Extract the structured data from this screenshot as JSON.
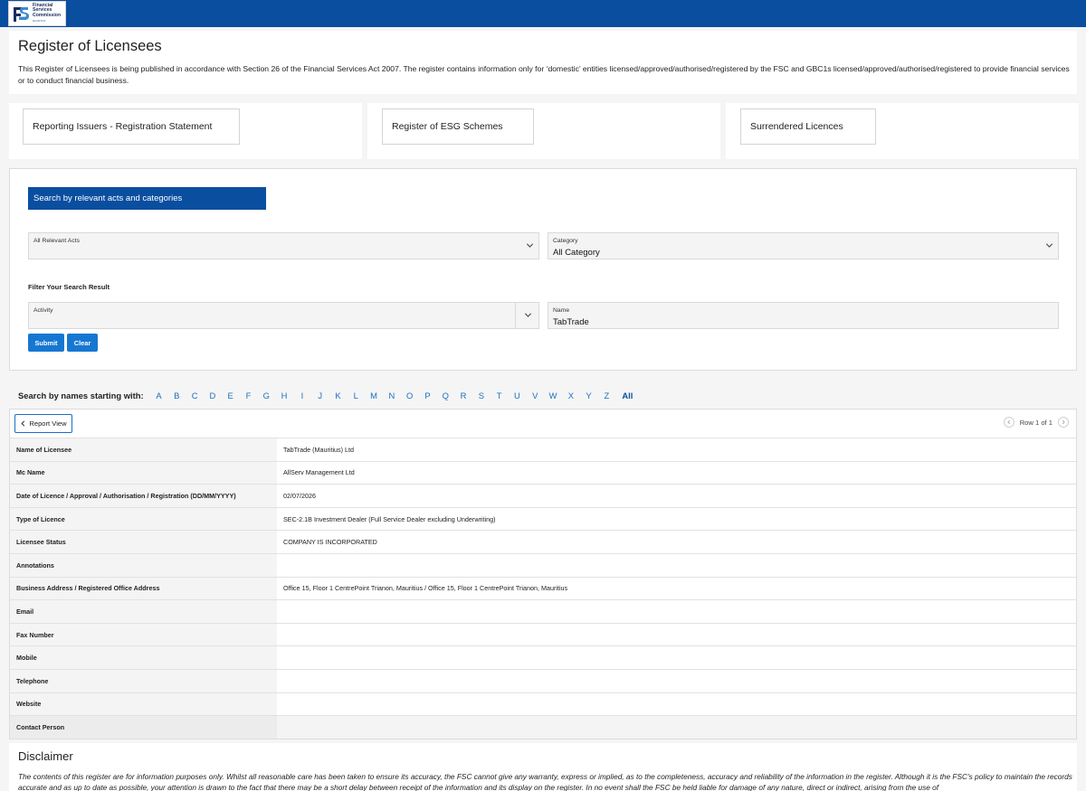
{
  "header": {
    "logo_line1": "Financial",
    "logo_line2": "Services",
    "logo_line3": "Commission",
    "logo_line4": "MAURITIUS"
  },
  "intro": {
    "title": "Register of Licensees",
    "text": "This Register of Licensees is being published in accordance with Section 26 of the Financial Services Act 2007. The register contains information only for ‘domestic’ entities licensed/approved/authorised/registered by the FSC and GBC1s licensed/approved/authorised/registered to provide financial services or to conduct financial business."
  },
  "cards": [
    {
      "label": "Reporting Issuers - Registration Statement"
    },
    {
      "label": "Register of ESG Schemes"
    },
    {
      "label": "Surrendered Licences"
    }
  ],
  "search": {
    "header": "Search by relevant acts and categories",
    "acts_label": "All Relevant Acts",
    "acts_value": "",
    "category_label": "Category",
    "category_value": "All Category",
    "filter_title": "Filter Your Search Result",
    "activity_label": "Activity",
    "activity_value": "",
    "name_label": "Name",
    "name_value": "TabTrade",
    "submit_label": "Submit",
    "clear_label": "Clear"
  },
  "alphabet": {
    "label": "Search by names starting with:",
    "letters": [
      "A",
      "B",
      "C",
      "D",
      "E",
      "F",
      "G",
      "H",
      "I",
      "J",
      "K",
      "L",
      "M",
      "N",
      "O",
      "P",
      "Q",
      "R",
      "S",
      "T",
      "U",
      "V",
      "W",
      "X",
      "Y",
      "Z"
    ],
    "all_label": "All"
  },
  "results": {
    "report_view_label": "Report View",
    "pager_text": "Row 1 of 1",
    "rows": [
      {
        "key": "Name of Licensee",
        "value": "TabTrade (Mauritius) Ltd"
      },
      {
        "key": "Mc Name",
        "value": "AllServ Management Ltd"
      },
      {
        "key": "Date of Licence / Approval / Authorisation / Registration (DD/MM/YYYY)",
        "value": "02/07/2026"
      },
      {
        "key": "Type of Licence",
        "value": "SEC-2.1B Investment Dealer (Full Service Dealer excluding Underwriting)"
      },
      {
        "key": "Licensee Status",
        "value": "COMPANY IS INCORPORATED"
      },
      {
        "key": "Annotations",
        "value": ""
      },
      {
        "key": "Business Address / Registered Office Address",
        "value": "Office 15, Floor 1 CentrePoint Trianon, Mauritius / Office 15, Floor 1 CentrePoint Trianon, Mauritius"
      },
      {
        "key": "Email",
        "value": ""
      },
      {
        "key": "Fax Number",
        "value": ""
      },
      {
        "key": "Mobile",
        "value": ""
      },
      {
        "key": "Telephone",
        "value": ""
      },
      {
        "key": "Website",
        "value": ""
      },
      {
        "key": "Contact Person",
        "value": ""
      }
    ]
  },
  "disclaimer": {
    "title": "Disclaimer",
    "text": "The contents of this register are for information purposes only. Whilst all reasonable care has been taken to ensure its accuracy, the FSC cannot give any warranty, express or implied, as to the completeness, accuracy and reliability of the information in the register. Although it is the FSC's policy to maintain the records accurate and as up to date as possible, your attention is drawn to the fact that there may be a short delay between receipt of the information and its display on the register. In no event shall the FSC be held liable for damage of any nature, direct or indirect, arising from the use of"
  },
  "colors": {
    "brand_blue": "#0a4ea0",
    "button_blue": "#1677d2",
    "link_blue": "#1a6fc4"
  }
}
